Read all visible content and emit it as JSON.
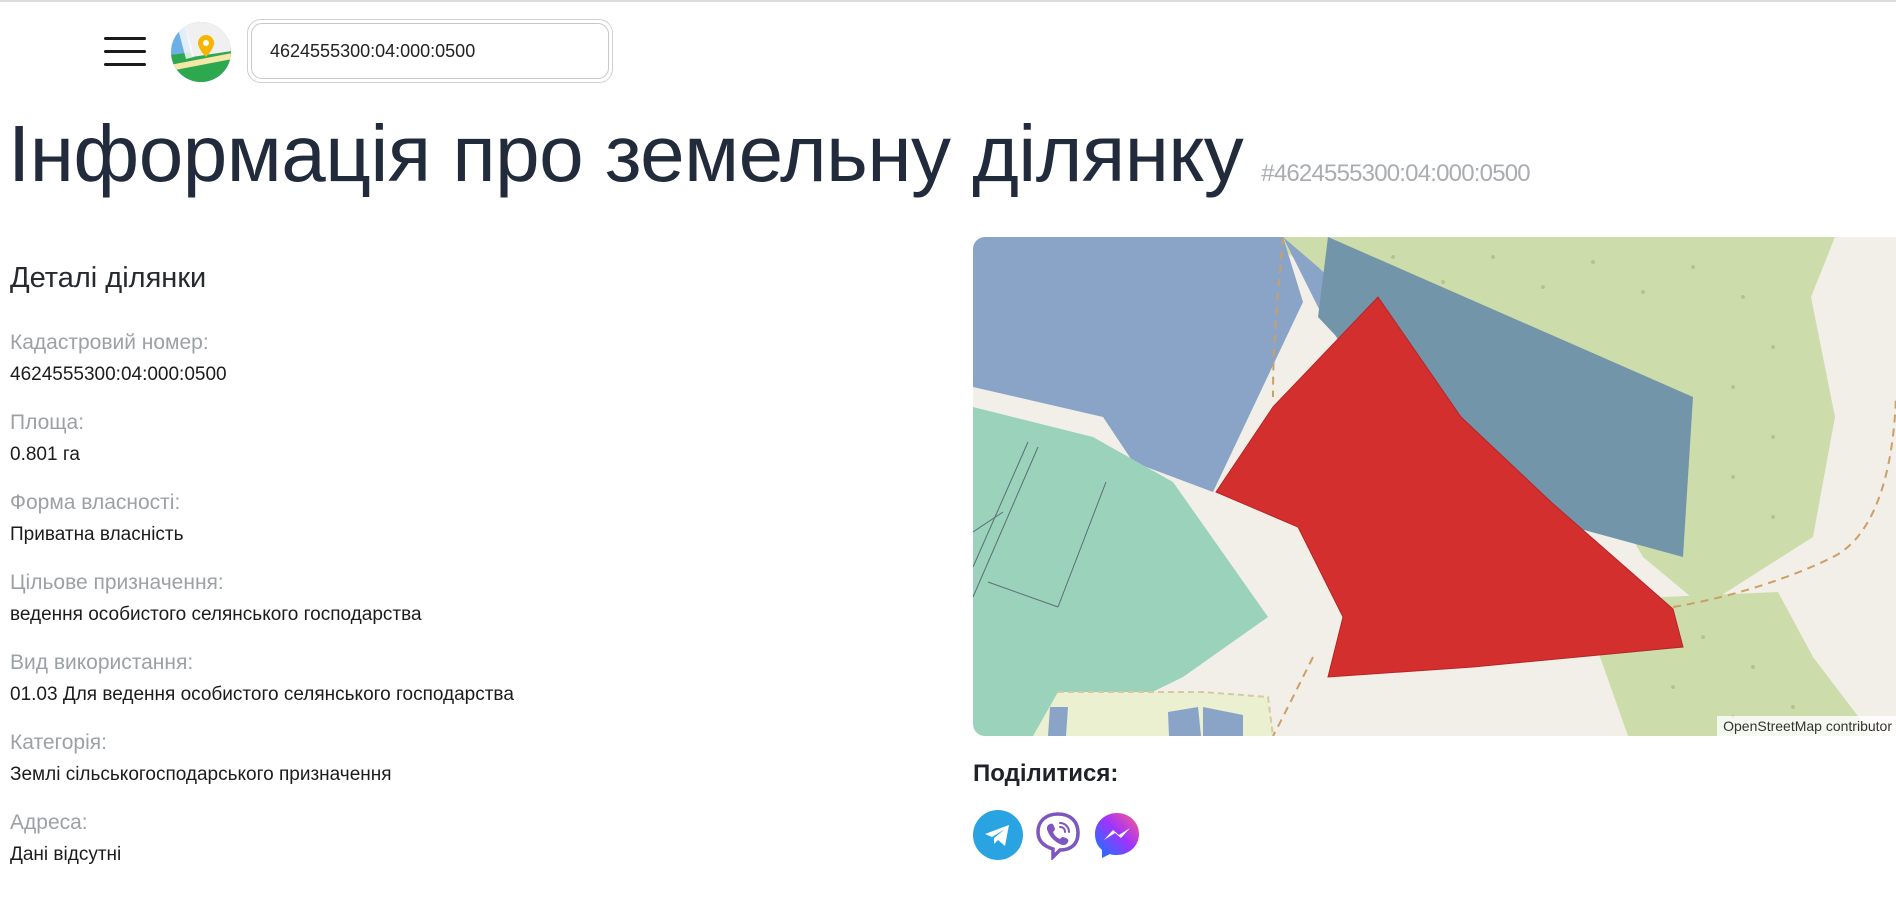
{
  "header": {
    "menu_icon": "hamburger-menu-icon",
    "logo_icon": "map-pin-logo-icon",
    "search": {
      "value": "4624555300:04:000:0500",
      "placeholder": ""
    }
  },
  "page": {
    "title": "Інформація про земельну ділянку",
    "subtitle": "#4624555300:04:000:0500"
  },
  "details": {
    "heading": "Деталі ділянки",
    "fields": [
      {
        "label": "Кадастровий номер:",
        "value": "4624555300:04:000:0500"
      },
      {
        "label": "Площа:",
        "value": "0.801 га"
      },
      {
        "label": "Форма власності:",
        "value": "Приватна власність"
      },
      {
        "label": "Цільове призначення:",
        "value": "ведення особистого селянського господарства"
      },
      {
        "label": "Вид використання:",
        "value": "01.03 Для ведення особистого селянського господарства"
      },
      {
        "label": "Категорія:",
        "value": "Землі сільськогосподарського призначення"
      },
      {
        "label": "Адреса:",
        "value": "Дані відсутні"
      }
    ]
  },
  "map": {
    "attribution": "OpenStreetMap contributor",
    "colors": {
      "highlight_parcel": "#d32f2f",
      "blue_parcel": "#8aa4c8",
      "dark_blue_parcel": "#7395aa",
      "green_parcel": "#9ad2bb",
      "meadow": "#cddcab",
      "road": "#f2efe9"
    }
  },
  "share": {
    "title": "Поділитися:",
    "buttons": [
      {
        "name": "telegram",
        "icon": "telegram-icon",
        "color": "#2aa3e3"
      },
      {
        "name": "viber",
        "icon": "viber-icon",
        "color": "#7d56c2"
      },
      {
        "name": "messenger",
        "icon": "messenger-icon",
        "color": "#a033ff"
      }
    ]
  }
}
